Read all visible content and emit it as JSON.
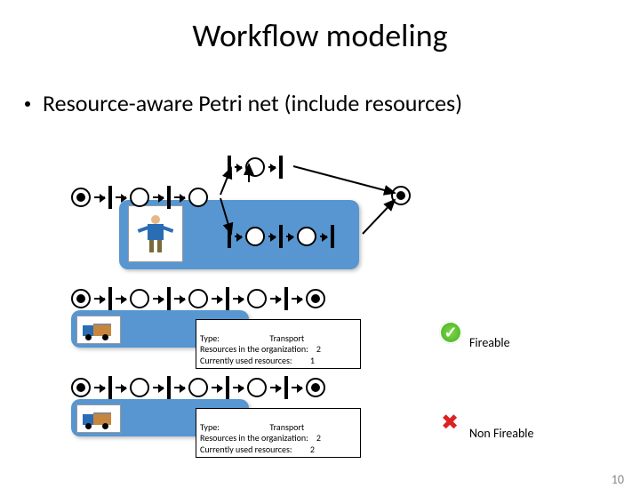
{
  "title": "Workflow modeling",
  "bullet": "Resource-aware Petri net (include resources)",
  "info1": {
    "type_label": "Type:",
    "type_value": "Transport",
    "org_label": "Resources in the organization:",
    "org_value": "2",
    "used_label": "Currently used resources:",
    "used_value": "1"
  },
  "info2": {
    "type_label": "Type:",
    "type_value": "Transport",
    "org_label": "Resources in the organization:",
    "org_value": "2",
    "used_label": "Currently used resources:",
    "used_value": "2"
  },
  "status_fireable": "Fireable",
  "status_nonfireable": "Non Fireable",
  "page_num": "10"
}
